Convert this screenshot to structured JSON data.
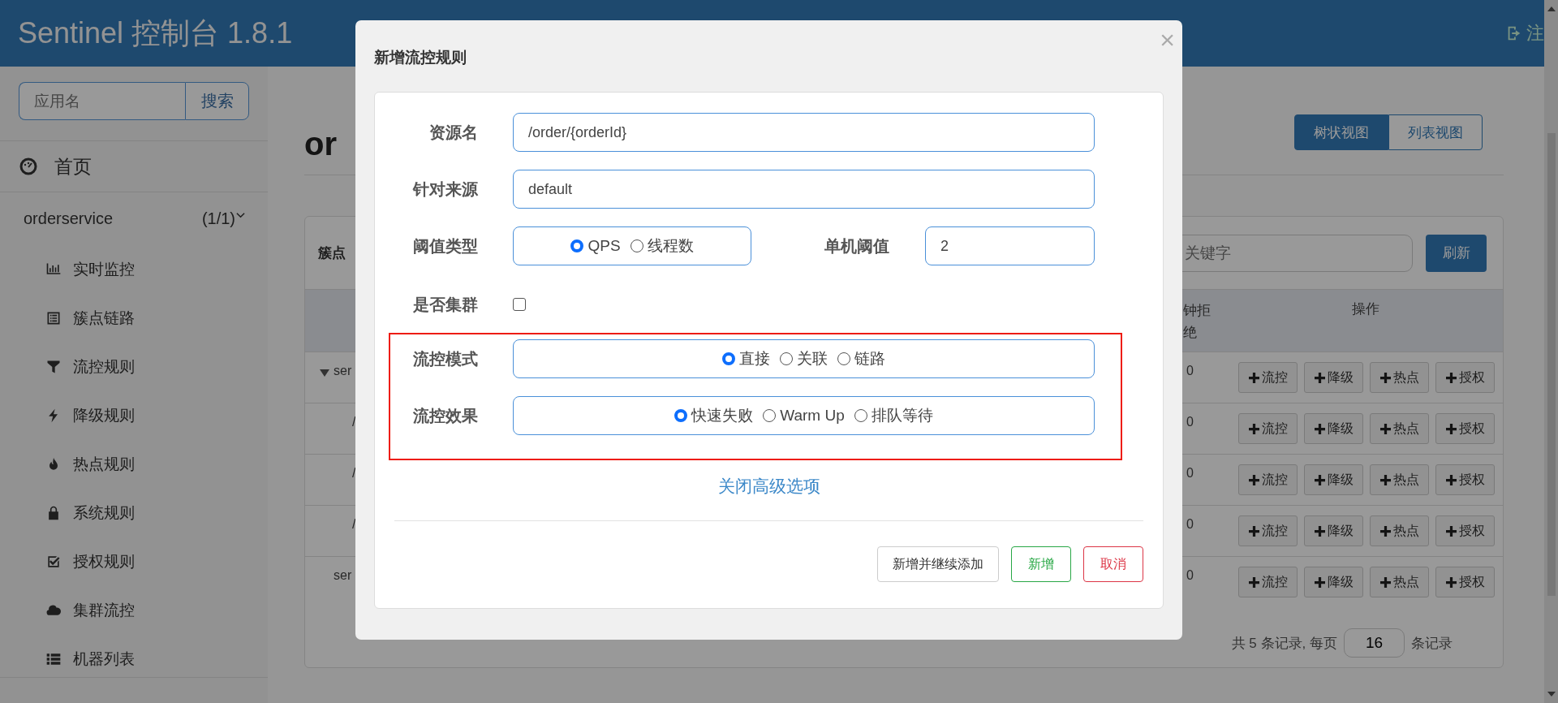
{
  "header": {
    "title": "Sentinel 控制台 1.8.1",
    "logout": "注"
  },
  "sidebar": {
    "search": {
      "placeholder": "应用名",
      "button": "搜索"
    },
    "home": "首页",
    "app": {
      "name": "orderservice",
      "count": "(1/1)",
      "expanded": true
    },
    "items": [
      {
        "label": "实时监控"
      },
      {
        "label": "簇点链路"
      },
      {
        "label": "流控规则"
      },
      {
        "label": "降级规则"
      },
      {
        "label": "热点规则"
      },
      {
        "label": "系统规则"
      },
      {
        "label": "授权规则"
      },
      {
        "label": "集群流控"
      },
      {
        "label": "机器列表"
      }
    ]
  },
  "page": {
    "title": "or",
    "views": [
      {
        "label": "树状视图",
        "selected": true
      },
      {
        "label": "列表视图",
        "selected": false
      }
    ]
  },
  "card": {
    "title": "簇点",
    "search": {
      "placeholder": "关键字"
    },
    "refresh": "刷新",
    "columns": [
      "钟拒绝",
      "操作"
    ],
    "rows": [
      {
        "name": "ser",
        "value": "0",
        "expanded": true,
        "actions": [
          "流控",
          "降级",
          "热点",
          "授权"
        ],
        "children": [
          {
            "name": "/",
            "value": "0",
            "actions": [
              "流控",
              "降级",
              "热点",
              "授权"
            ]
          },
          {
            "name": "/",
            "value": "0",
            "actions": [
              "流控",
              "降级",
              "热点",
              "授权"
            ]
          },
          {
            "name": "/",
            "value": "0",
            "actions": [
              "流控",
              "降级",
              "热点",
              "授权"
            ]
          }
        ]
      },
      {
        "name": "ser",
        "value": "0",
        "actions": [
          "流控",
          "降级",
          "热点",
          "授权"
        ]
      }
    ],
    "pagination": {
      "before": "共 5 条记录, 每页",
      "page_size": "16",
      "after": "条记录"
    }
  },
  "modal": {
    "title": "新增流控规则",
    "close": "×",
    "resource": {
      "label": "资源名",
      "value": "/order/{orderId}"
    },
    "origin": {
      "label": "针对来源",
      "value": "default"
    },
    "threshold_type": {
      "label": "阈值类型",
      "options": [
        {
          "label": "QPS",
          "selected": true
        },
        {
          "label": "线程数",
          "selected": false
        }
      ]
    },
    "threshold": {
      "label": "单机阈值",
      "value": "2"
    },
    "cluster": {
      "label": "是否集群",
      "checked": false
    },
    "mode": {
      "label": "流控模式",
      "options": [
        {
          "label": "直接",
          "selected": true
        },
        {
          "label": "关联",
          "selected": false
        },
        {
          "label": "链路",
          "selected": false
        }
      ]
    },
    "effect": {
      "label": "流控效果",
      "options": [
        {
          "label": "快速失败",
          "selected": true
        },
        {
          "label": "Warm Up",
          "selected": false
        },
        {
          "label": "排队等待",
          "selected": false
        }
      ]
    },
    "toggle_link": "关闭高级选项",
    "buttons": [
      {
        "label": "新增并继续添加",
        "kind": "default"
      },
      {
        "label": "新增",
        "kind": "success"
      },
      {
        "label": "取消",
        "kind": "danger"
      }
    ]
  }
}
